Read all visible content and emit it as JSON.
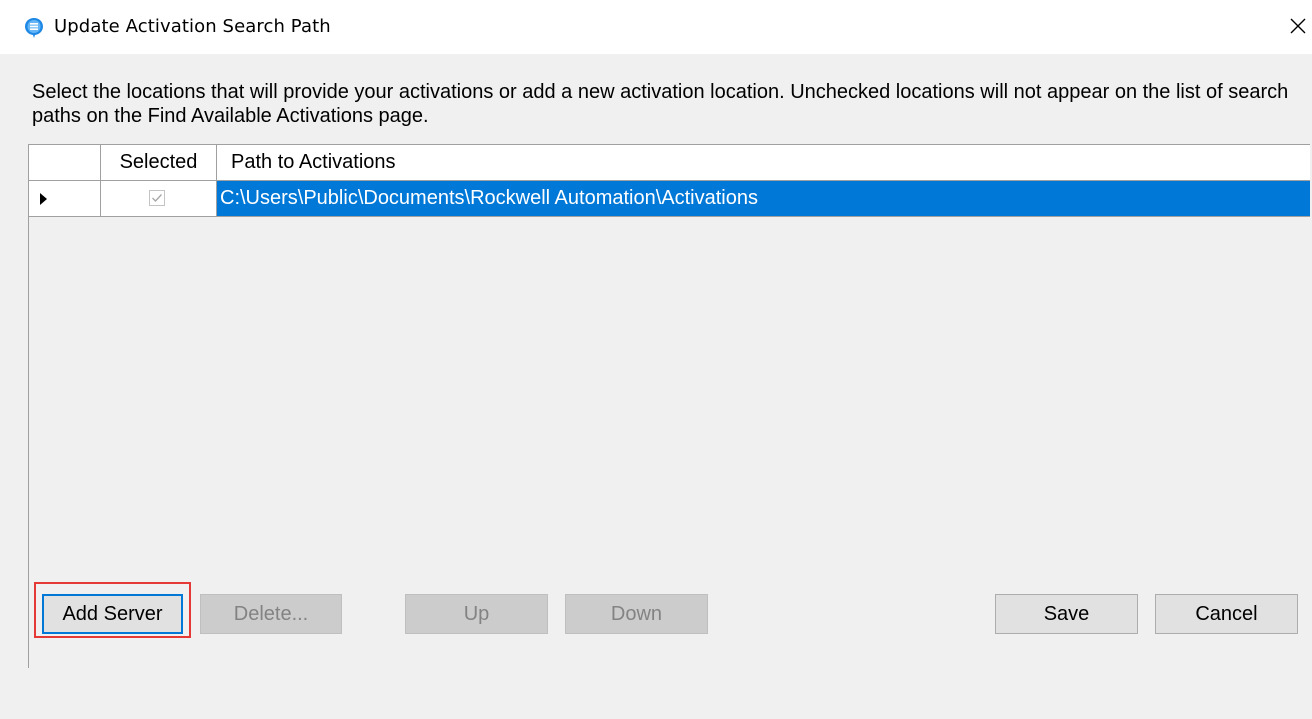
{
  "window": {
    "title": "Update Activation Search Path",
    "icon": "activation-app-icon",
    "close_icon": "close-icon"
  },
  "instructions": "Select the locations that will provide your activations or add a new activation location. Unchecked locations will not appear on the list of search paths on the Find Available Activations page.",
  "grid": {
    "columns": [
      "",
      "Selected",
      "Path to Activations"
    ],
    "rows": [
      {
        "current": true,
        "selected": true,
        "path": "C:\\Users\\Public\\Documents\\Rockwell Automation\\Activations"
      }
    ]
  },
  "buttons": {
    "add_server": "Add Server",
    "delete": "Delete...",
    "up": "Up",
    "down": "Down",
    "save": "Save",
    "cancel": "Cancel"
  },
  "colors": {
    "selection": "#0078d7",
    "highlight_box": "#e53935",
    "dialog_background": "#f0f0f0"
  }
}
